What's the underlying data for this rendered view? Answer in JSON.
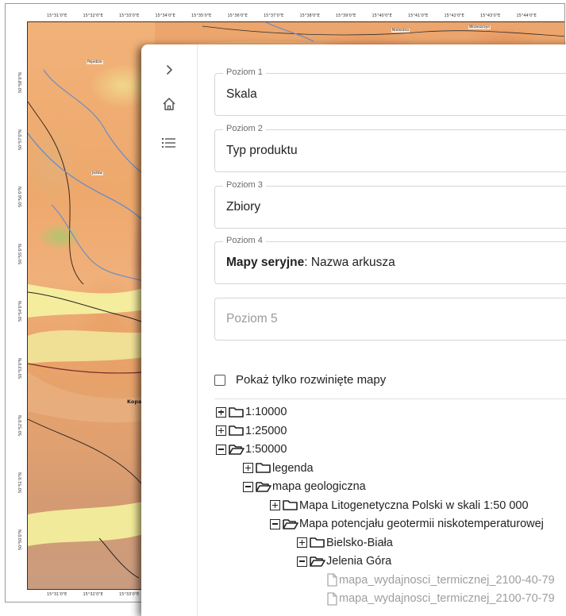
{
  "map": {
    "top_coords": [
      "15°31'0\"E",
      "15°32'0\"E",
      "15°33'0\"E",
      "15°34'0\"E",
      "15°35'0\"E",
      "15°36'0\"E",
      "15°37'0\"E",
      "15°38'0\"E",
      "15°39'0\"E",
      "15°40'0\"E",
      "15°41'0\"E",
      "15°42'0\"E",
      "15°43'0\"E",
      "15°44'0\"E"
    ],
    "bottom_coords": [
      "15°31'0\"E",
      "15°32'0\"E",
      "15°33'0\"E"
    ],
    "left_coords": [
      "50°58'0\"N",
      "50°57'0\"N",
      "50°56'0\"N",
      "50°55'0\"N",
      "50°54'0\"N",
      "50°53'0\"N",
      "50°52'0\"N",
      "50°51'0\"N",
      "50°50'0\"N"
    ],
    "places": [
      "Nielestno",
      "Pojedzie",
      "Jeżów",
      "Kopaniec",
      "Wrzeszczyn"
    ]
  },
  "nav": {
    "expand_icon": "chevron-right-icon",
    "home_icon": "home-icon",
    "list_icon": "list-icon"
  },
  "levels": [
    {
      "label": "Poziom 1",
      "value": "Skala"
    },
    {
      "label": "Poziom 2",
      "value": "Typ produktu"
    },
    {
      "label": "Poziom 3",
      "value": "Zbiory"
    },
    {
      "label": "Poziom 4",
      "value_bold": "Mapy seryjne",
      "value_rest": ": Nazwa arkusza"
    },
    {
      "label": "",
      "placeholder": "Poziom 5"
    }
  ],
  "filter": {
    "only_expanded_label": "Pokaż tylko rozwinięte mapy",
    "only_expanded_checked": false
  },
  "tree": [
    {
      "label": "1:10000",
      "depth": 0,
      "kind": "folder",
      "expanded": false
    },
    {
      "label": "1:25000",
      "depth": 0,
      "kind": "folder",
      "expanded": false
    },
    {
      "label": "1:50000",
      "depth": 0,
      "kind": "folder",
      "expanded": true
    },
    {
      "label": "legenda",
      "depth": 1,
      "kind": "folder",
      "expanded": false
    },
    {
      "label": "mapa geologiczna",
      "depth": 1,
      "kind": "folder",
      "expanded": true
    },
    {
      "label": "Mapa Litogenetyczna Polski w skali 1:50 000",
      "depth": 2,
      "kind": "folder",
      "expanded": false
    },
    {
      "label": "Mapa potencjału geotermii niskotemperaturowej",
      "depth": 2,
      "kind": "folder",
      "expanded": true
    },
    {
      "label": "Bielsko-Biała",
      "depth": 3,
      "kind": "folder",
      "expanded": false
    },
    {
      "label": "Jelenia Góra",
      "depth": 3,
      "kind": "folder",
      "expanded": true
    },
    {
      "label": "mapa_wydajnosci_termicznej_2100-40-79",
      "depth": 4,
      "kind": "file"
    },
    {
      "label": "mapa_wydajnosci_termicznej_2100-70-79",
      "depth": 4,
      "kind": "file"
    }
  ],
  "colors": {
    "accent": "#212121",
    "muted": "#9e9e9e",
    "border": "#d6d6d6"
  }
}
